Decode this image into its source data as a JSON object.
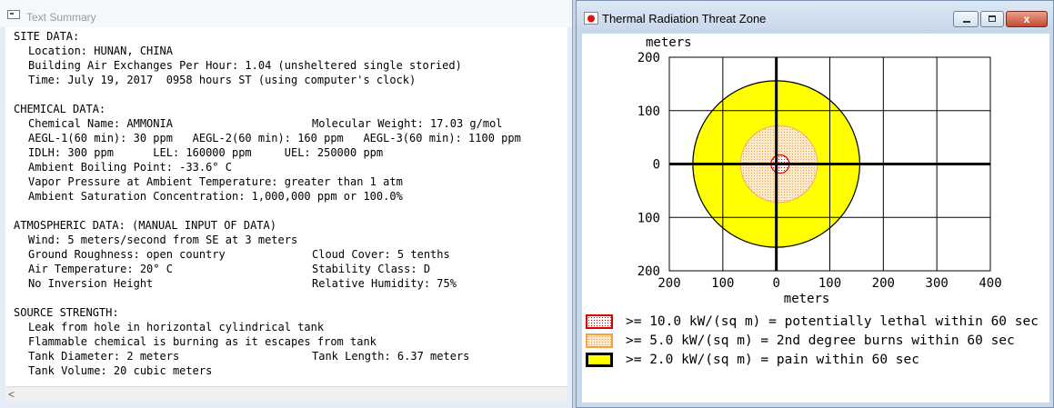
{
  "text_summary": {
    "title": "Text Summary",
    "sections": [
      {
        "header": "SITE DATA:",
        "lines": [
          {
            "text": "Location: HUNAN, CHINA"
          },
          {
            "text": "Building Air Exchanges Per Hour: 1.04 (unsheltered single storied)"
          },
          {
            "text": "Time: July 19, 2017  0958 hours ST (using computer's clock)"
          }
        ]
      },
      {
        "header": "CHEMICAL DATA:",
        "lines": [
          {
            "text": "Chemical Name: AMMONIA",
            "col2": "Molecular Weight: 17.03 g/mol"
          },
          {
            "text": "AEGL-1(60 min): 30 ppm   AEGL-2(60 min): 160 ppm   AEGL-3(60 min): 1100 ppm"
          },
          {
            "text": "IDLH: 300 ppm      LEL: 160000 ppm     UEL: 250000 ppm"
          },
          {
            "text": "Ambient Boiling Point: -33.6° C"
          },
          {
            "text": "Vapor Pressure at Ambient Temperature: greater than 1 atm"
          },
          {
            "text": "Ambient Saturation Concentration: 1,000,000 ppm or 100.0%"
          }
        ]
      },
      {
        "header": "ATMOSPHERIC DATA: (MANUAL INPUT OF DATA)",
        "lines": [
          {
            "text": "Wind: 5 meters/second from SE at 3 meters"
          },
          {
            "text": "Ground Roughness: open country",
            "col2": "Cloud Cover: 5 tenths"
          },
          {
            "text": "Air Temperature: 20° C",
            "col2": "Stability Class: D"
          },
          {
            "text": "No Inversion Height",
            "col2": "Relative Humidity: 75%"
          }
        ]
      },
      {
        "header": "SOURCE STRENGTH:",
        "lines": [
          {
            "text": "Leak from hole in horizontal cylindrical tank"
          },
          {
            "text": "Flammable chemical is burning as it escapes from tank"
          },
          {
            "text": "Tank Diameter: 2 meters",
            "col2": "Tank Length: 6.37 meters"
          },
          {
            "text": "Tank Volume: 20 cubic meters"
          }
        ]
      }
    ],
    "scroll_left_glyph": "<"
  },
  "threat_zone": {
    "title": "Thermal Radiation Threat Zone",
    "controls": {
      "minimize": "minimize",
      "maximize": "maximize",
      "close": "x"
    },
    "chart_data": {
      "type": "map",
      "y_axis_title": "meters",
      "x_axis_title": "meters",
      "xlim": [
        -200,
        400
      ],
      "ylim": [
        -200,
        200
      ],
      "x_ticks": [
        -200,
        -100,
        0,
        100,
        200,
        300,
        400
      ],
      "x_tick_labels": [
        "200",
        "100",
        "0",
        "100",
        "200",
        "300",
        "400"
      ],
      "y_ticks": [
        200,
        100,
        0,
        -100,
        -200
      ],
      "y_tick_labels": [
        "200",
        "100",
        "0",
        "100",
        "200"
      ],
      "grid": true,
      "zones": [
        {
          "level": "yellow",
          "center": [
            0,
            0
          ],
          "radius": 156,
          "color": "#ffff00",
          "stroke": "#000000",
          "fill_pattern": "solid"
        },
        {
          "level": "orange",
          "center": [
            5,
            0
          ],
          "radius": 72,
          "color": "#f7dfb8",
          "stroke": "#f4b45a",
          "fill_pattern": "dotted"
        },
        {
          "level": "red",
          "center": [
            7,
            0
          ],
          "radius": 17,
          "color": "#ffffff",
          "stroke": "#e00000",
          "fill_pattern": "dotted"
        }
      ],
      "legend": [
        {
          "label": ">= 10.0 kW/(sq m) = potentially lethal within 60 sec",
          "swatch_fill": "#ffffff",
          "swatch_border": "#e00000",
          "pattern": "dotted-red"
        },
        {
          "label": ">= 5.0 kW/(sq m) = 2nd degree burns within 60 sec",
          "swatch_fill": "#f7dfb8",
          "swatch_border": "#f4a23c",
          "pattern": "dotted-orange"
        },
        {
          "label": ">= 2.0 kW/(sq m) = pain within 60 sec",
          "swatch_fill": "#ffff00",
          "swatch_border": "#000000",
          "pattern": "solid"
        }
      ]
    }
  }
}
